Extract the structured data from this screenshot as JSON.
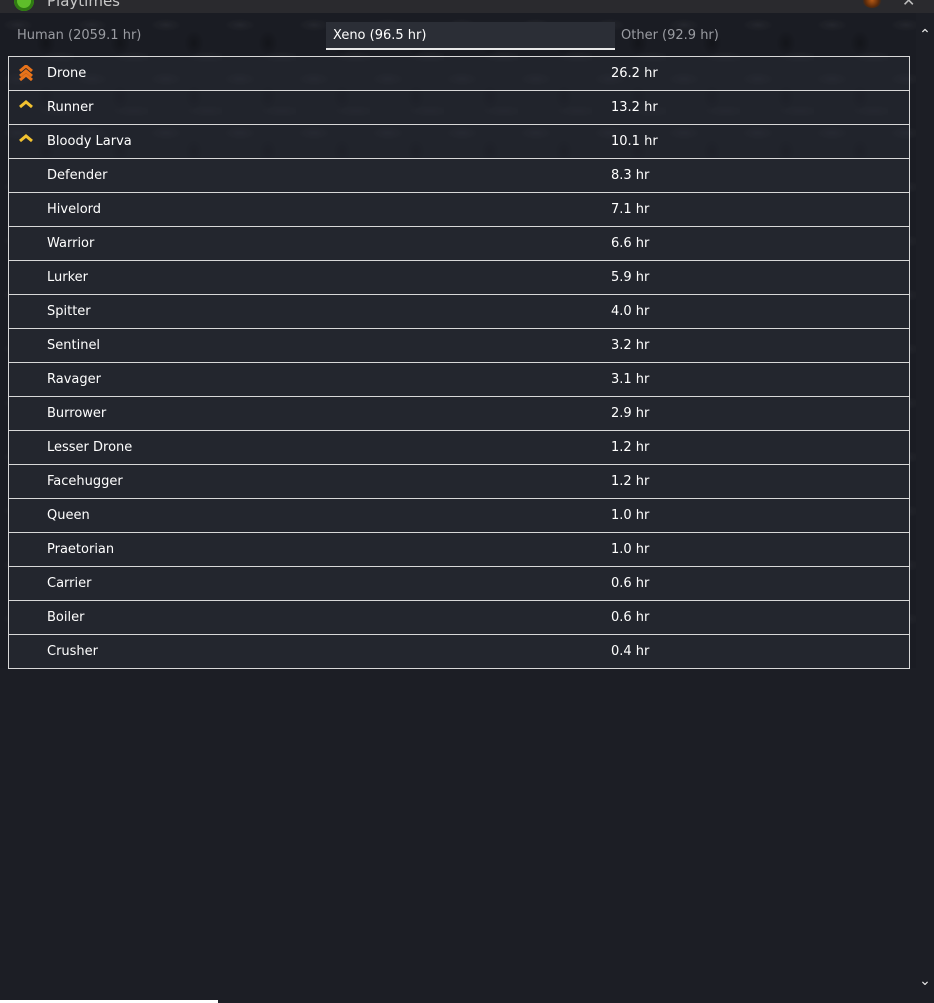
{
  "window": {
    "title": "Playtimes",
    "app_icon": "green-circle-icon",
    "close_label": "✕"
  },
  "tabs": [
    {
      "label": "Human (2059.1 hr)",
      "selected": false
    },
    {
      "label": "Xeno (96.5 hr)",
      "selected": true
    },
    {
      "label": "Other (92.9 hr)",
      "selected": false
    }
  ],
  "rows": [
    {
      "name": "Drone",
      "time": "26.2 hr",
      "icon": "triple-chevron-orange-icon"
    },
    {
      "name": "Runner",
      "time": "13.2 hr",
      "icon": "chevron-yellow-icon"
    },
    {
      "name": "Bloody Larva",
      "time": "10.1 hr",
      "icon": "chevron-yellow-icon"
    },
    {
      "name": "Defender",
      "time": "8.3 hr"
    },
    {
      "name": "Hivelord",
      "time": "7.1 hr"
    },
    {
      "name": "Warrior",
      "time": "6.6 hr"
    },
    {
      "name": "Lurker",
      "time": "5.9 hr"
    },
    {
      "name": "Spitter",
      "time": "4.0 hr"
    },
    {
      "name": "Sentinel",
      "time": "3.2 hr"
    },
    {
      "name": "Ravager",
      "time": "3.1 hr"
    },
    {
      "name": "Burrower",
      "time": "2.9 hr"
    },
    {
      "name": "Lesser Drone",
      "time": "1.2 hr"
    },
    {
      "name": "Facehugger",
      "time": "1.2 hr"
    },
    {
      "name": "Queen",
      "time": "1.0 hr"
    },
    {
      "name": "Praetorian",
      "time": "1.0 hr"
    },
    {
      "name": "Carrier",
      "time": "0.6 hr"
    },
    {
      "name": "Boiler",
      "time": "0.6 hr"
    },
    {
      "name": "Crusher",
      "time": "0.4 hr"
    }
  ],
  "colors": {
    "rank_orange": "#e8731a",
    "rank_yellow": "#f2c230",
    "border": "#d8d8d8",
    "selected_tab_bg": "#2b2e36"
  },
  "scrollbar": {
    "up_icon": "chevron-up-icon",
    "down_icon": "chevron-down-icon",
    "up_glyph": "⌃",
    "down_glyph": "⌄"
  }
}
